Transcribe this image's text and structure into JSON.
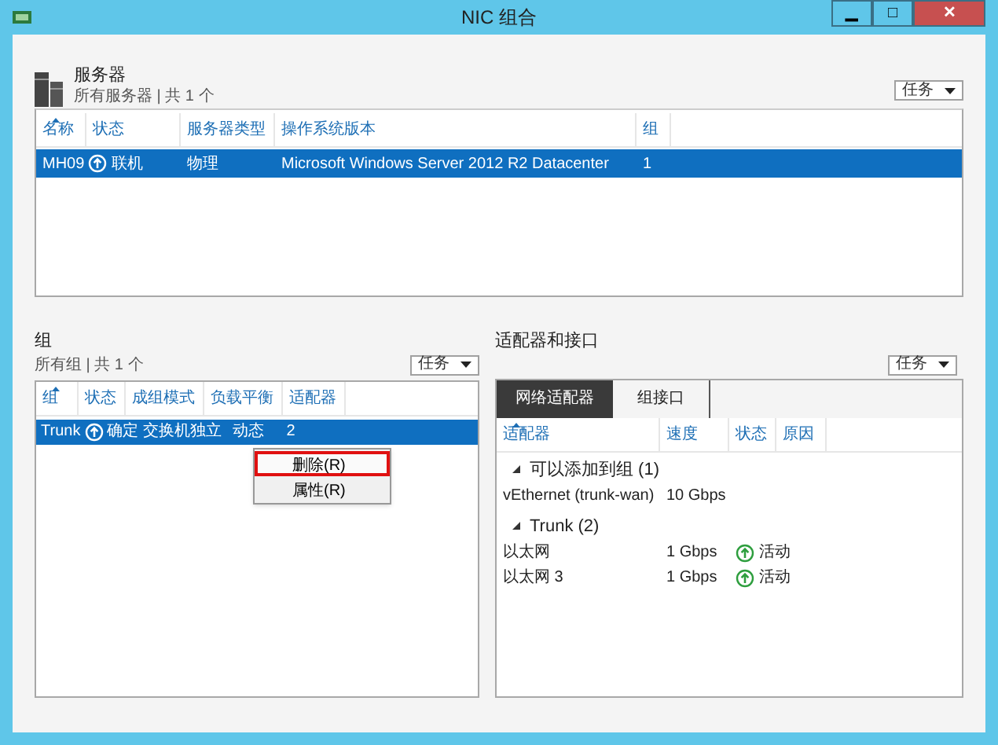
{
  "window": {
    "title": "NIC 组合",
    "controls": [
      "▁",
      "□",
      "✕"
    ]
  },
  "servers": {
    "title": "服务器",
    "subtitle": "所有服务器 | 共 1 个",
    "tasks": "任务",
    "columns": [
      {
        "label": "名称",
        "sorted": true
      },
      {
        "label": "状态",
        "sorted": false
      },
      {
        "label": "服务器类型",
        "sorted": false
      },
      {
        "label": "操作系统版本",
        "sorted": false
      },
      {
        "label": "组",
        "sorted": false
      }
    ],
    "rows": [
      {
        "selected": true,
        "cells": [
          "MH09",
          "联机",
          "物理",
          "Microsoft Windows Server 2012 R2 Datacenter",
          "1"
        ]
      }
    ]
  },
  "groups": {
    "title": "组",
    "subtitle": "所有组 | 共 1 个",
    "tasks": "任务",
    "columns": [
      {
        "label": "组",
        "sorted": true
      },
      {
        "label": "状态",
        "sorted": false
      },
      {
        "label": "成组模式",
        "sorted": false
      },
      {
        "label": "负载平衡",
        "sorted": false
      },
      {
        "label": "适配器",
        "sorted": false
      }
    ],
    "rows": [
      {
        "selected": true,
        "cells": [
          "Trunk",
          "确定",
          "交换机独立",
          "动态",
          "2"
        ]
      }
    ]
  },
  "context_menu": {
    "items": [
      {
        "label": "删除(R)",
        "highlighted": true
      },
      {
        "label": "属性(R)",
        "highlighted": false
      }
    ]
  },
  "adapters": {
    "title": "适配器和接口",
    "tasks": "任务",
    "tabs": [
      {
        "label": "网络适配器",
        "selected": true
      },
      {
        "label": "组接口",
        "selected": false
      }
    ],
    "columns": [
      {
        "label": "适配器",
        "sorted": true
      },
      {
        "label": "速度",
        "sorted": false
      },
      {
        "label": "状态",
        "sorted": false
      },
      {
        "label": "原因",
        "sorted": false
      }
    ],
    "sections": [
      {
        "title": "可以添加到组 (1)",
        "expanded": true,
        "rows": [
          {
            "name": "vEthernet (trunk-wan)",
            "speed": "10 Gbps"
          }
        ]
      },
      {
        "title": "Trunk (2)",
        "expanded": true,
        "rows": [
          {
            "name": "以太网",
            "speed": "1 Gbps",
            "status": "活动"
          },
          {
            "name": "以太网 3",
            "speed": "1 Gbps",
            "status": "活动"
          }
        ]
      }
    ]
  }
}
